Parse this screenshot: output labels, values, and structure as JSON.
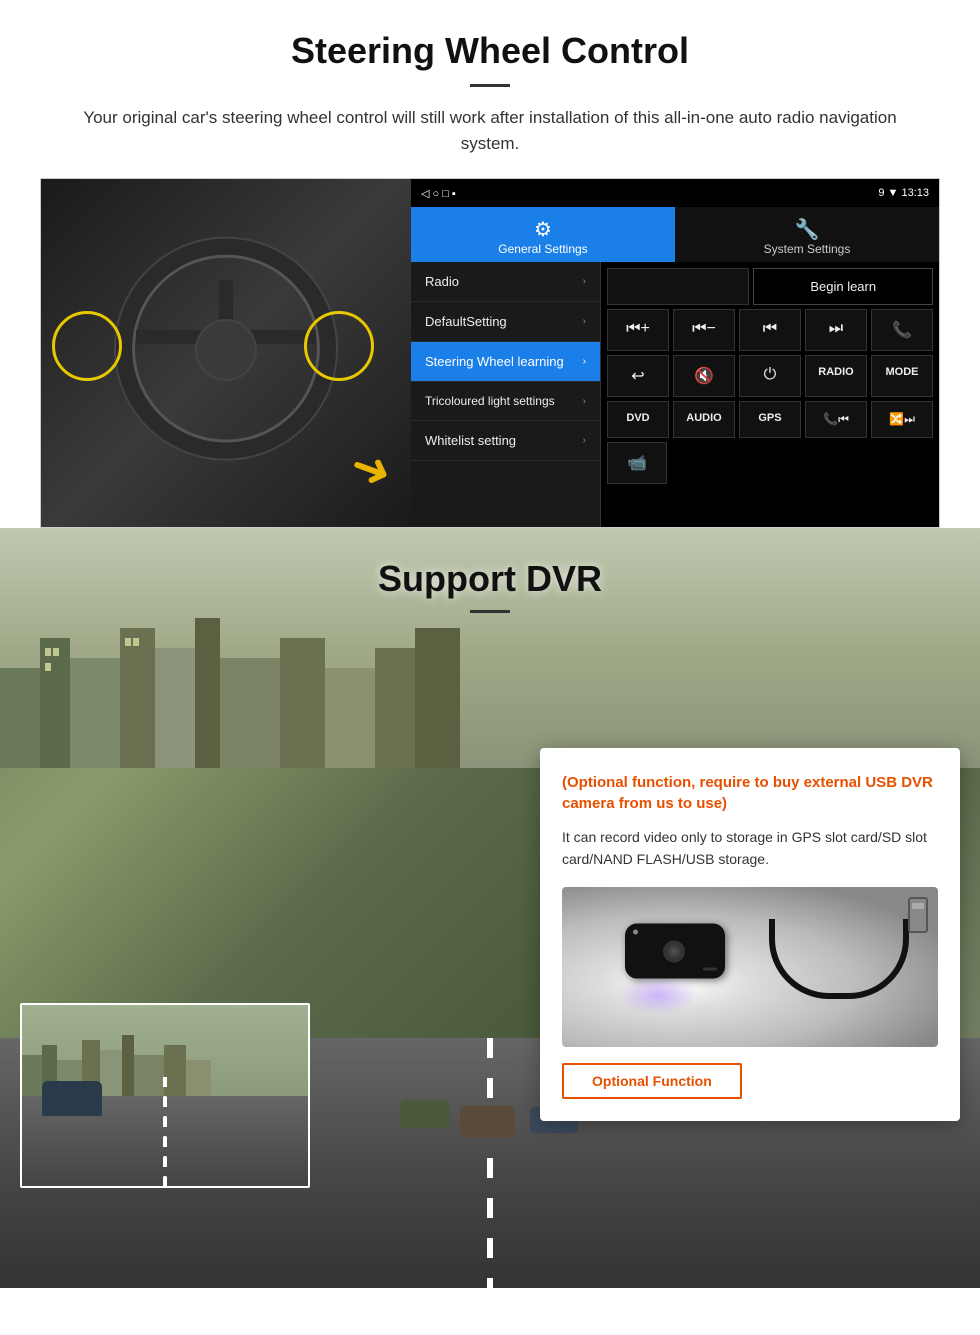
{
  "steering": {
    "title": "Steering Wheel Control",
    "description": "Your original car's steering wheel control will still work after installation of this all-in-one auto radio navigation system.",
    "tabs": {
      "active": {
        "icon": "⚙",
        "label": "General Settings"
      },
      "inactive": {
        "icon": "🔧",
        "label": "System Settings"
      }
    },
    "menu_items": [
      {
        "label": "Radio",
        "active": false
      },
      {
        "label": "DefaultSetting",
        "active": false
      },
      {
        "label": "Steering Wheel learning",
        "active": true
      },
      {
        "label": "Tricoloured light settings",
        "active": false
      },
      {
        "label": "Whitelist setting",
        "active": false
      }
    ],
    "begin_learn": "Begin learn",
    "control_buttons": [
      [
        "⏮+",
        "⏮−",
        "⏮|",
        "⏭|",
        "📞"
      ],
      [
        "↩",
        "🔇",
        "⏻",
        "RADIO",
        "MODE"
      ],
      [
        "DVD",
        "AUDIO",
        "GPS",
        "📞⏮|",
        "🔀⏭|"
      ]
    ],
    "statusbar": {
      "left_icons": "◁  ○  □  ▪",
      "right": "9 ▼ 13:13"
    }
  },
  "dvr": {
    "title": "Support DVR",
    "optional_note": "(Optional function, require to buy external USB DVR camera from us to use)",
    "description": "It can record video only to storage in GPS slot card/SD slot card/NAND FLASH/USB storage.",
    "optional_btn_label": "Optional Function"
  }
}
